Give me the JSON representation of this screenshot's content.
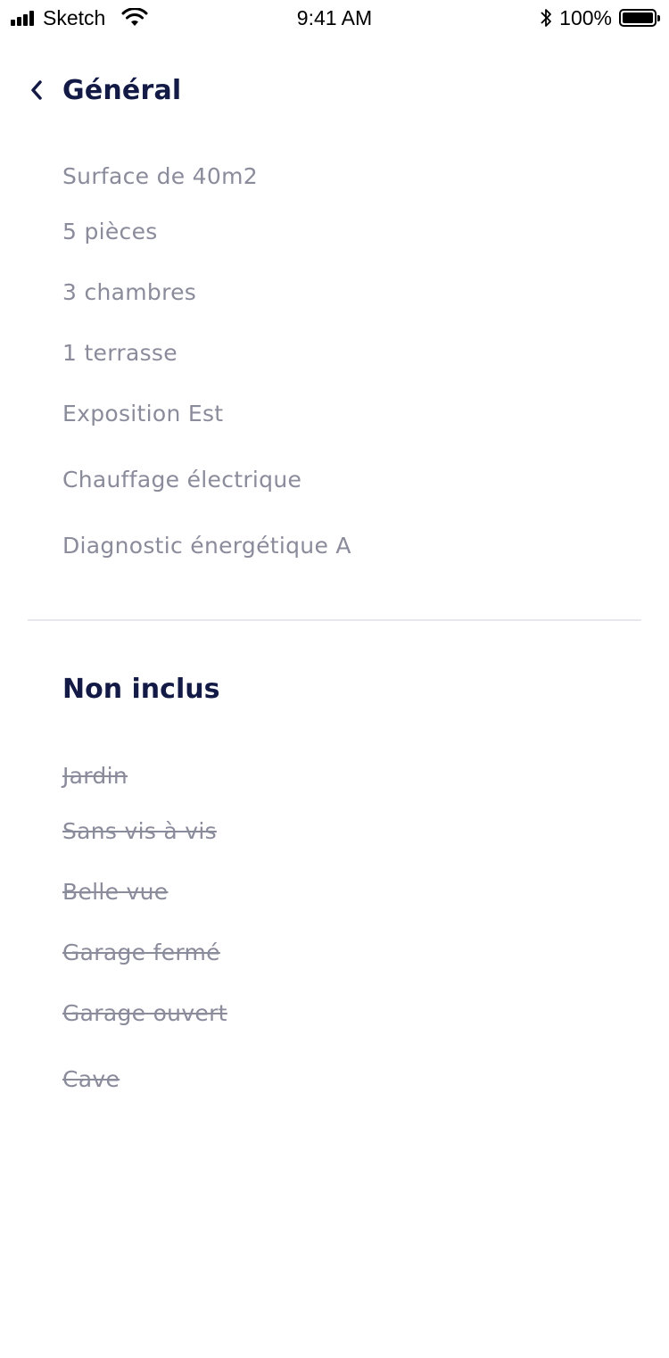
{
  "status_bar": {
    "carrier": "Sketch",
    "time": "9:41 AM",
    "battery_percent": "100%",
    "battery_level": 1.0,
    "signal_icon": "signal-icon",
    "wifi_icon": "wifi-icon",
    "bluetooth_icon": "bluetooth-icon",
    "battery_icon": "battery-icon"
  },
  "header": {
    "back_icon": "chevron-left-icon",
    "title": "Général"
  },
  "included": [
    "Surface de 40m2",
    "5 pièces",
    "3 chambres",
    "1 terrasse",
    "Exposition Est",
    "Chauffage électrique",
    "Diagnostic énergétique A"
  ],
  "not_included": {
    "title": "Non inclus",
    "items": [
      "Jardin",
      "Sans vis à vis",
      "Belle vue",
      "Garage fermé",
      "Garage ouvert",
      "Cave"
    ]
  },
  "colors": {
    "title": "#121a45",
    "item_text": "#8a8b9b",
    "divider": "#e8e8ec"
  }
}
